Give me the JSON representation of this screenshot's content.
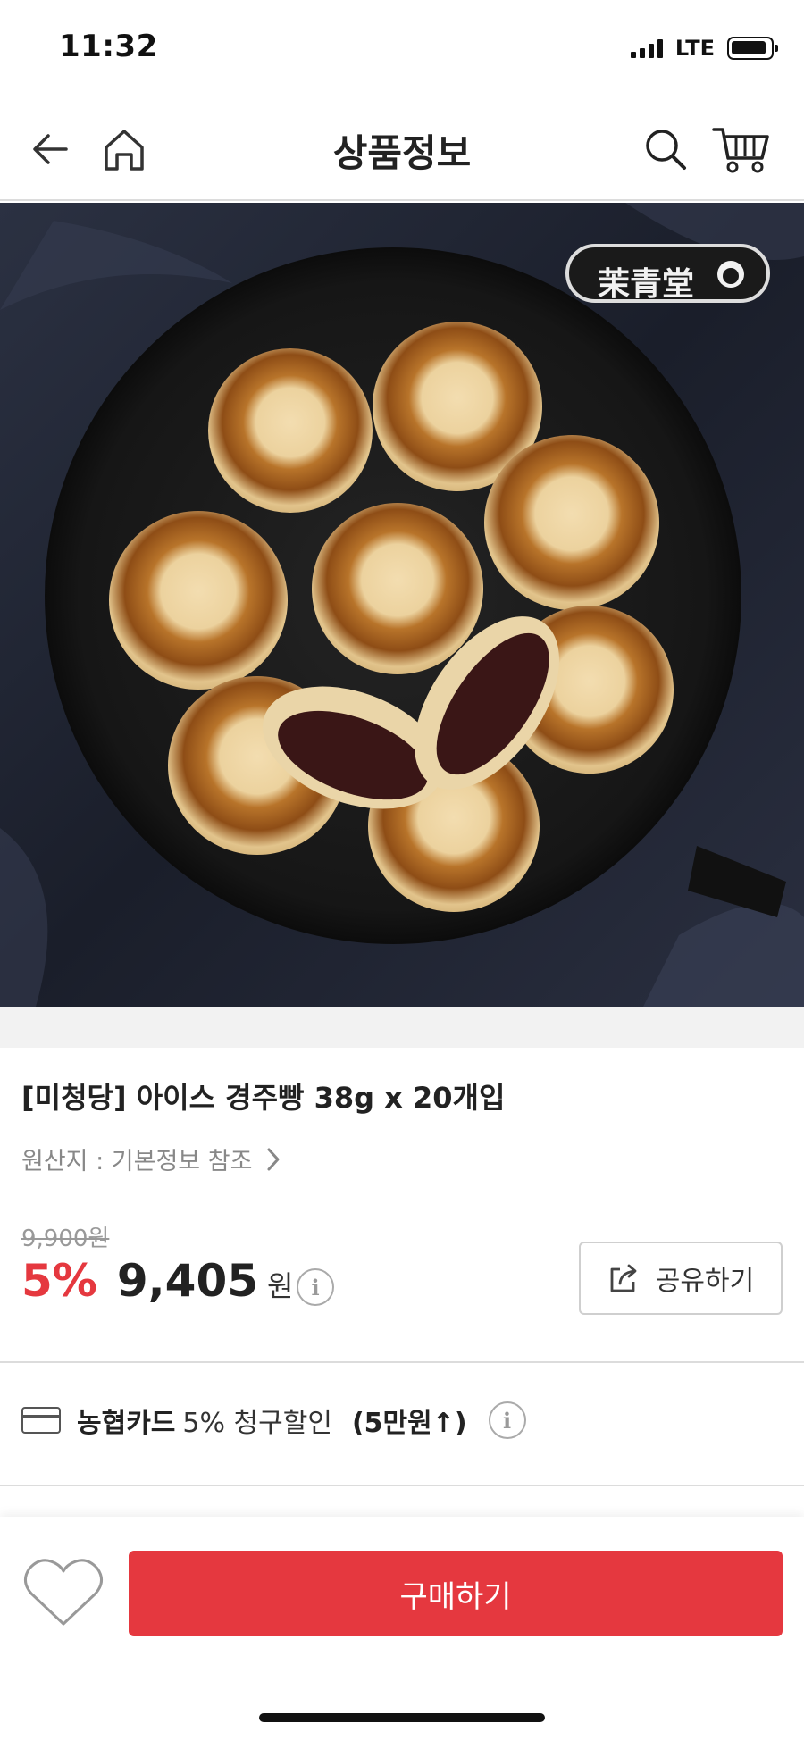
{
  "status_bar": {
    "time": "11:32",
    "network": "LTE"
  },
  "header": {
    "title": "상품정보"
  },
  "image": {
    "brand_stamp": "茉青堂"
  },
  "product": {
    "title": "[미청당] 아이스 경주빵 38g x 20개입",
    "origin": "원산지 : 기본정보 참조",
    "original_price": "9,900원",
    "discount": "5%",
    "price": "9,405",
    "currency": "원",
    "share_label": "공유하기"
  },
  "card_promo": {
    "bank": "농협카드",
    "desc": "5% 청구할인",
    "condition": "(5만원↑)"
  },
  "bottom": {
    "buy_label": "구매하기"
  },
  "colors": {
    "accent": "#e5383f",
    "divider": "#dcdcdc"
  }
}
